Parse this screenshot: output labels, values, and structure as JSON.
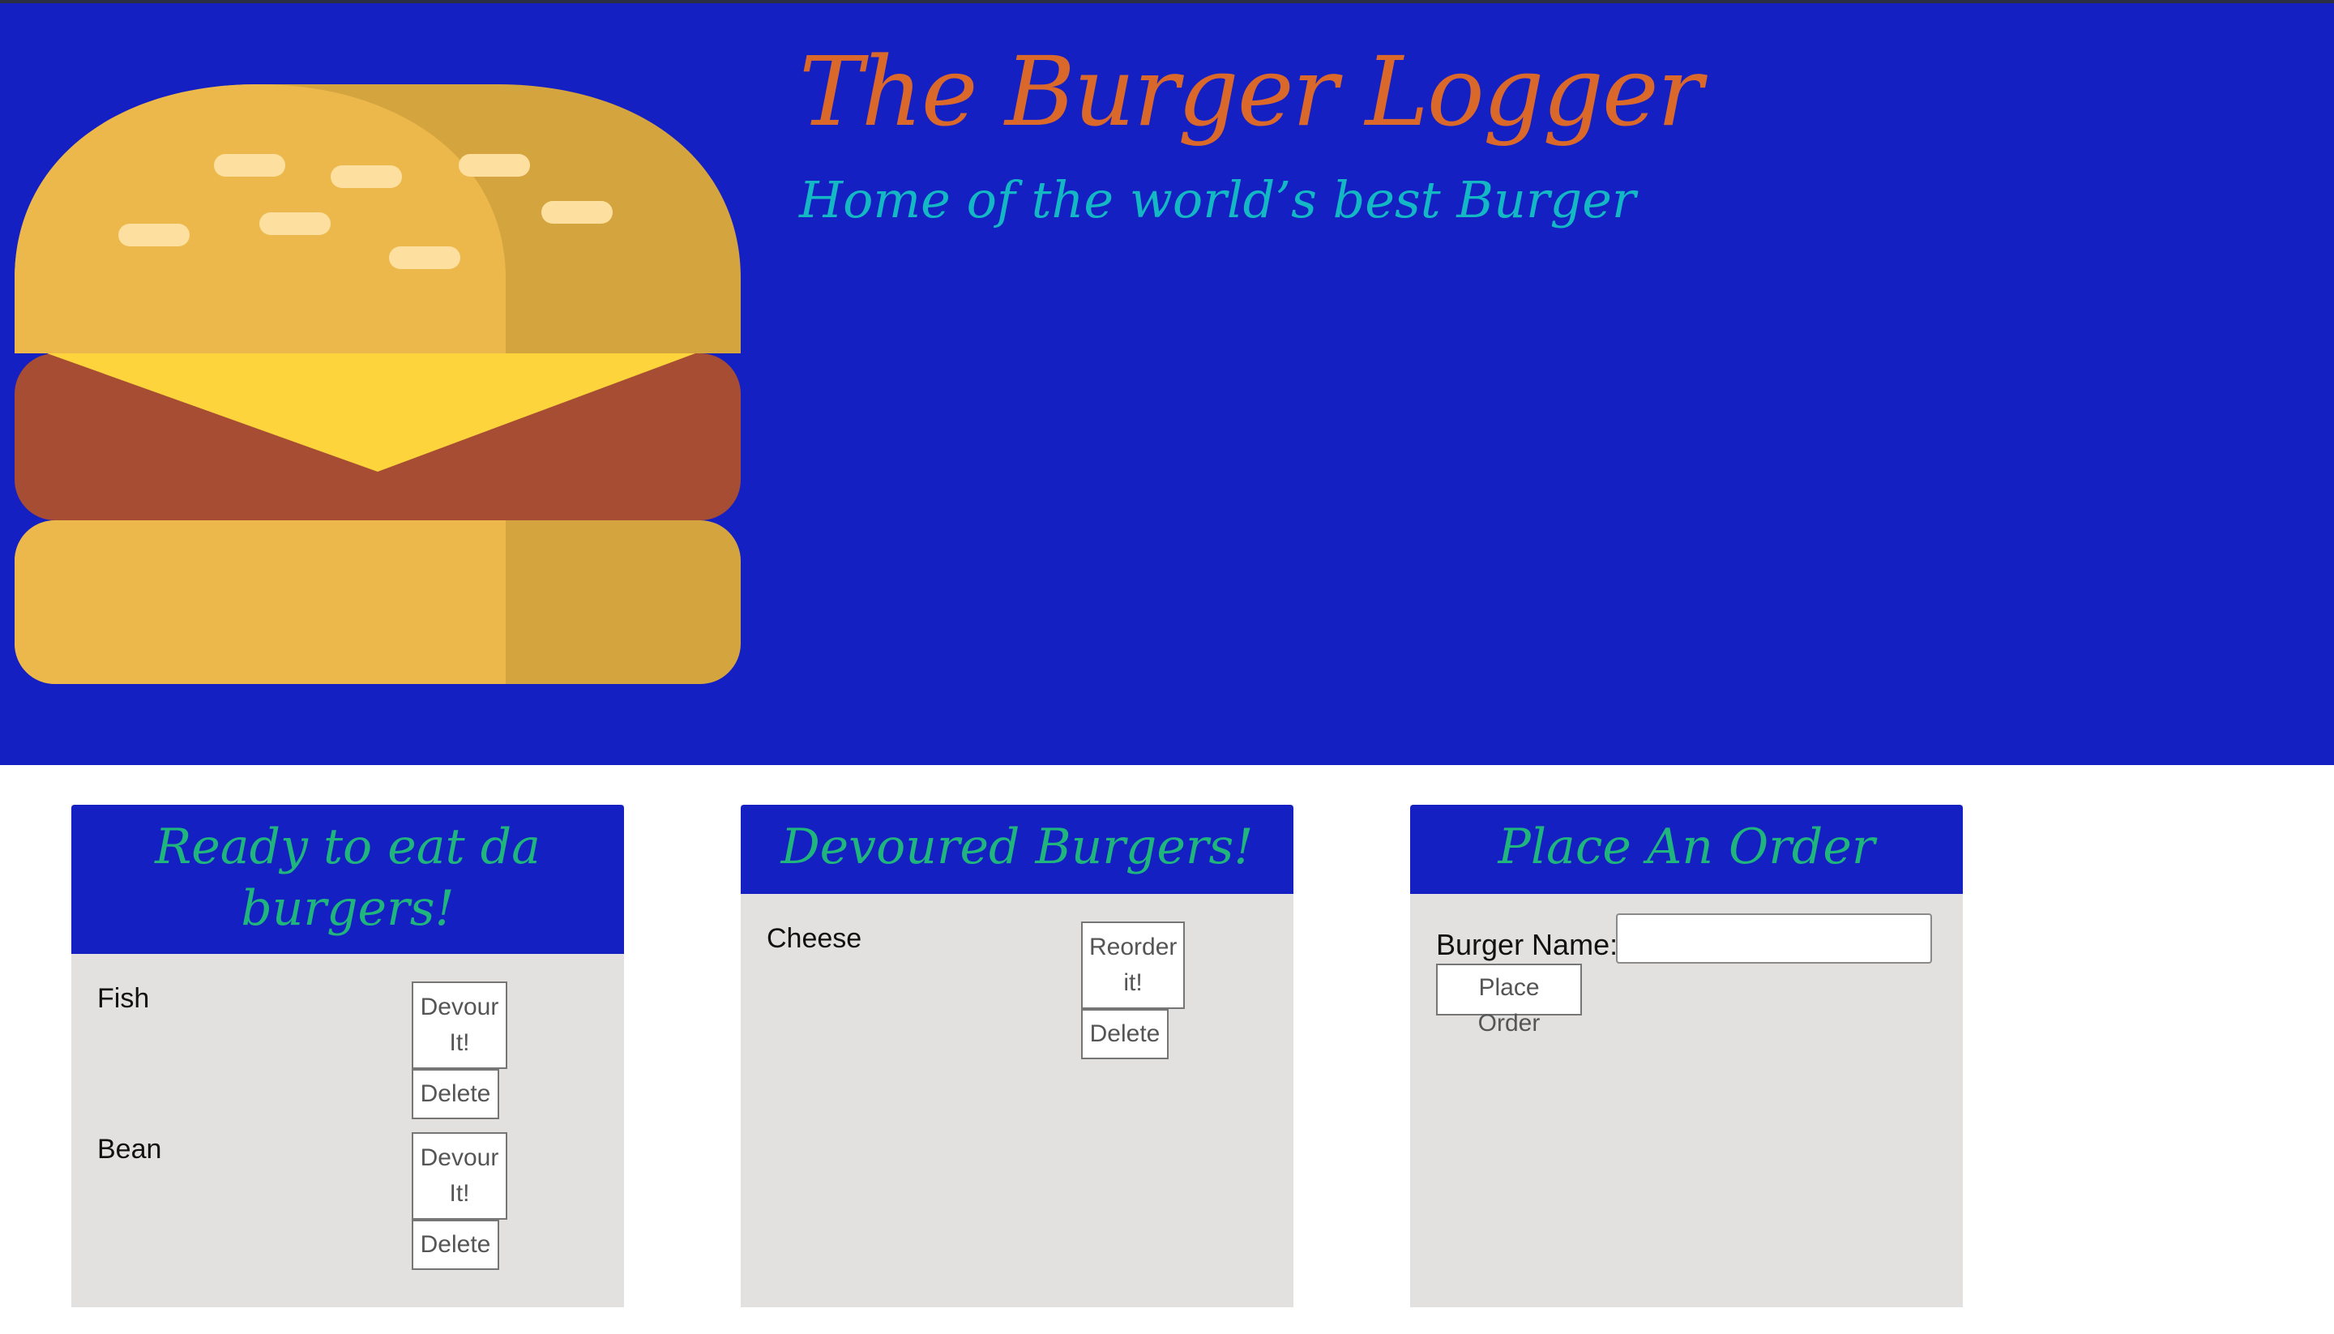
{
  "header": {
    "title": "The Burger Logger",
    "subtitle": "Home of the world’s best Burger",
    "logo_icon": "burger-icon",
    "colors": {
      "background": "#1520c3",
      "title": "#d9682a",
      "subtitle": "#14b8c4"
    }
  },
  "ready_panel": {
    "heading": "Ready to eat da burgers!",
    "items": [
      {
        "name": "Fish",
        "action_label": "Devour It!",
        "delete_label": "Delete"
      },
      {
        "name": "Bean",
        "action_label": "Devour It!",
        "delete_label": "Delete"
      }
    ]
  },
  "devoured_panel": {
    "heading": "Devoured Burgers!",
    "items": [
      {
        "name": "Cheese",
        "action_label": "Reorder it!",
        "delete_label": "Delete"
      }
    ]
  },
  "order_panel": {
    "heading": "Place An Order",
    "field_label": "Burger Name:",
    "field_value": "",
    "submit_label": "Place Order"
  },
  "colors": {
    "panel_header": "#1520c3",
    "panel_heading_text": "#21b57e",
    "panel_body": "#e2e1df"
  }
}
